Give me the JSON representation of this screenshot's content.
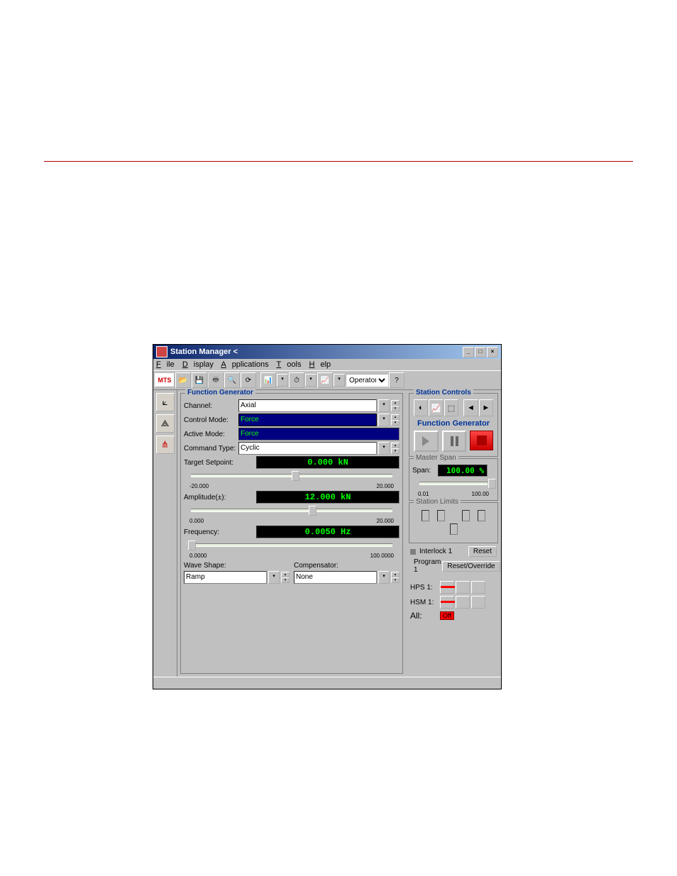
{
  "window": {
    "title": "Station Manager <"
  },
  "menu": {
    "file": "File",
    "display": "Display",
    "applications": "Applications",
    "tools": "Tools",
    "help": "Help"
  },
  "toolbar": {
    "role": "Operator"
  },
  "fg": {
    "title": "Function Generator",
    "channel": {
      "label": "Channel:",
      "value": "Axial"
    },
    "controlMode": {
      "label": "Control Mode:",
      "value": "Force"
    },
    "activeMode": {
      "label": "Active Mode:",
      "value": "Force"
    },
    "commandType": {
      "label": "Command Type:",
      "value": "Cyclic"
    },
    "setpoint": {
      "label": "Target Setpoint:",
      "value": "0.000 kN",
      "min": "-20.000",
      "max": "20.000"
    },
    "amplitude": {
      "label": "Amplitude(±):",
      "value": "12.000 kN",
      "min": "0.000",
      "max": "20.000"
    },
    "frequency": {
      "label": "Frequency:",
      "value": "0.0050 Hz",
      "min": "0.0000",
      "max": "100.0000"
    },
    "waveShape": {
      "label": "Wave Shape:",
      "value": "Ramp"
    },
    "compensator": {
      "label": "Compensator:",
      "value": "None"
    }
  },
  "sc": {
    "title": "Station Controls",
    "fgTitle": "Function Generator",
    "masterSpan": {
      "title": "Master Span",
      "label": "Span:",
      "value": "100.00  %",
      "min": "0.01",
      "max": "100.00"
    },
    "limits": {
      "title": "Station Limits"
    },
    "interlock": {
      "label": "Interlock 1",
      "reset": "Reset"
    },
    "program": {
      "label": "Program 1",
      "reset": "Reset/Override"
    },
    "hps": {
      "label": "HPS 1:"
    },
    "hsm": {
      "label": "HSM 1:"
    },
    "all": {
      "label": "All:",
      "value": "Off"
    }
  }
}
